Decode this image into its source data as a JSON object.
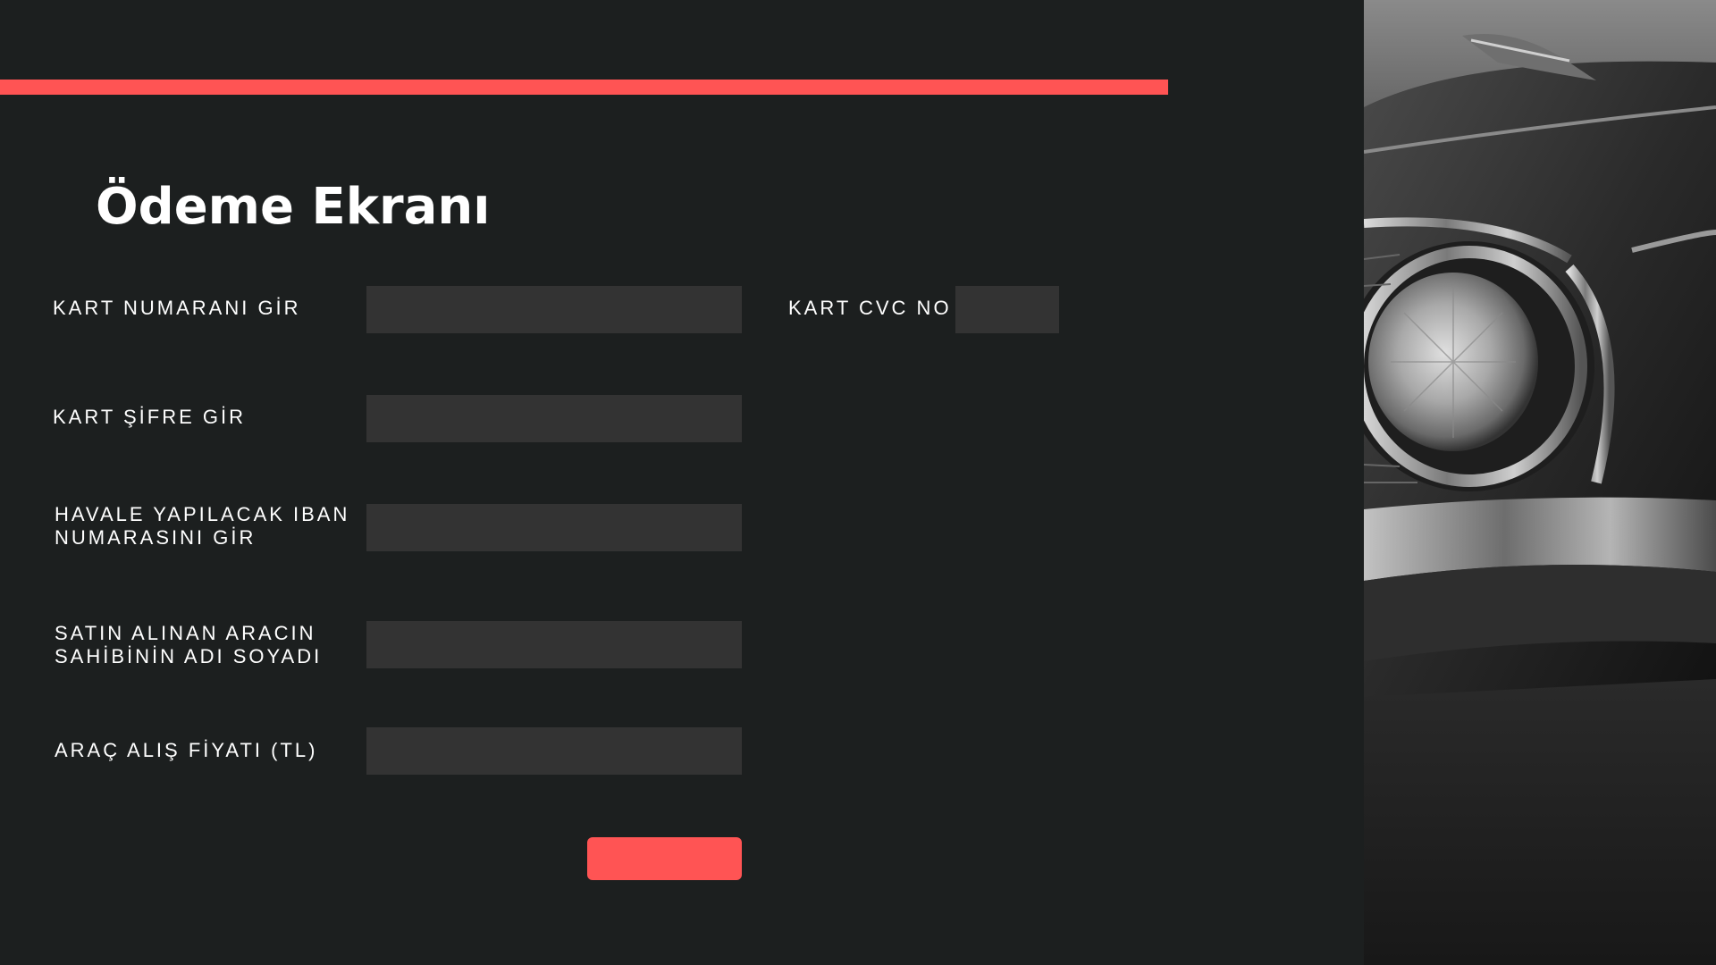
{
  "page": {
    "title": "Ödeme Ekranı",
    "accent_color": "#ff5454",
    "background_color": "#1c1f1f",
    "field_color": "#333333"
  },
  "form": {
    "card_number": {
      "label": "KART NUMARANI GİR",
      "value": "",
      "placeholder": ""
    },
    "card_cvc": {
      "label": "KART CVC NO",
      "value": "",
      "placeholder": ""
    },
    "card_pin": {
      "label": "KART ŞİFRE GİR",
      "value": "",
      "placeholder": ""
    },
    "iban": {
      "label_line1": "HAVALE YAPILACAK IBAN",
      "label_line2": "NUMARASINI GİR",
      "value": "",
      "placeholder": ""
    },
    "owner_name": {
      "label_line1": "SATIN ALINAN ARACIN",
      "label_line2": "SAHİBİNİN ADI SOYADI",
      "value": "",
      "placeholder": ""
    },
    "price": {
      "label": "ARAÇ ALIŞ FİYATI (TL)",
      "value": "",
      "placeholder": ""
    },
    "submit_label": ""
  },
  "image": {
    "subject": "car-headlight-photo",
    "style": "black-and-white"
  }
}
